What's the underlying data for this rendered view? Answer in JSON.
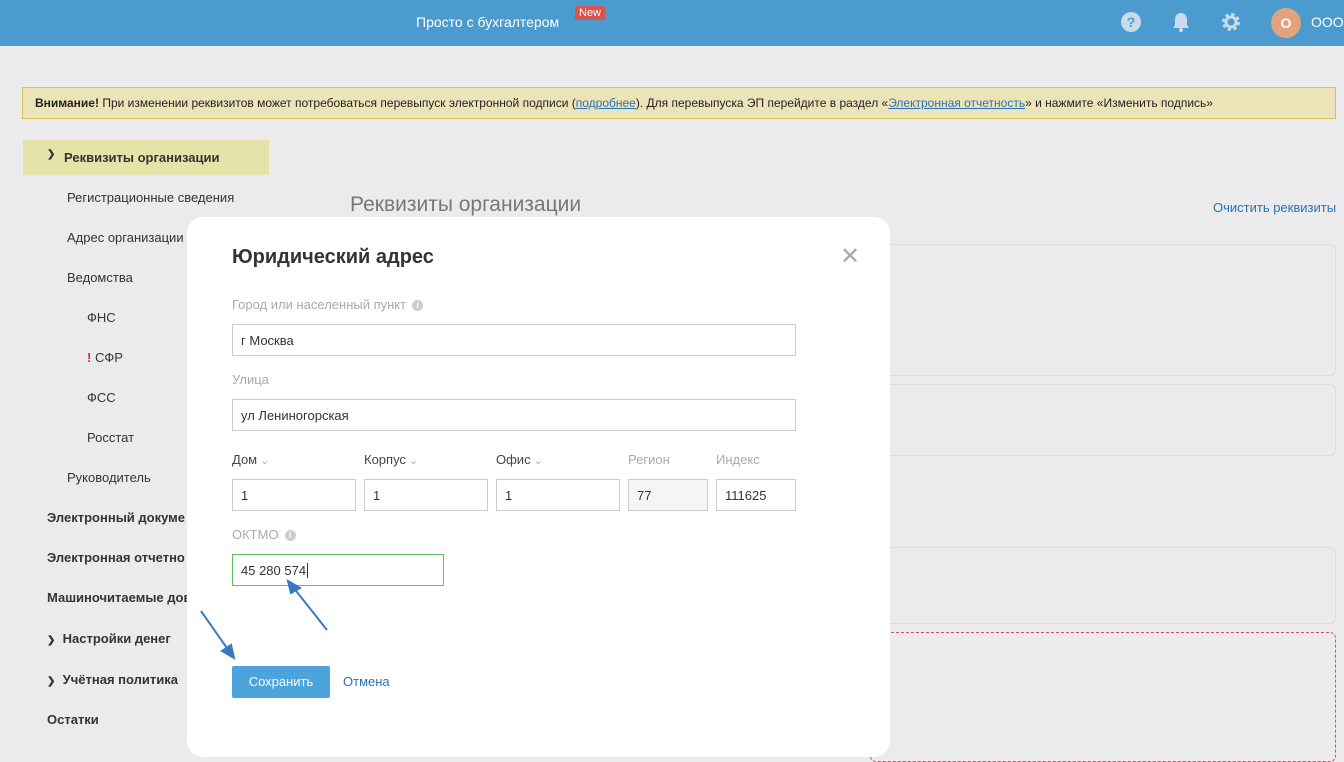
{
  "header": {
    "brand": "Просто с бухгалтером",
    "new_badge": "New",
    "avatar_letter": "О",
    "org": "ООО"
  },
  "warning": {
    "bold": "Внимание!",
    "text1": " При изменении реквизитов может потребоваться перевыпуск электронной подписи (",
    "link1": "подробнее",
    "text2": "). Для перевыпуска ЭП перейдите в раздел «",
    "link2": "Электронная отчетность",
    "text3": "» и нажмите «Изменить подпись»"
  },
  "sidebar": {
    "active": "Реквизиты организации",
    "items": [
      "Регистрационные сведения",
      "Адрес организации",
      "Ведомства",
      "ФНС",
      "СФР",
      "ФСС",
      "Росстат",
      "Руководитель",
      "Электронный докуме",
      "Электронная отчетно",
      "Машиночитаемые дов",
      "Настройки денег",
      "Учётная политика",
      "Остатки"
    ],
    "alert_mark": "!"
  },
  "main": {
    "title": "Реквизиты организации",
    "clear_link": "Очистить реквизиты"
  },
  "modal": {
    "title": "Юридический адрес",
    "city_label": "Город или населенный пункт",
    "city_value": "г Москва",
    "street_label": "Улица",
    "street_value": "ул Лениногорская",
    "house_label": "Дом",
    "house_value": "1",
    "korpus_label": "Корпус",
    "korpus_value": "1",
    "office_label": "Офис",
    "office_value": "1",
    "region_label": "Регион",
    "region_value": "77",
    "index_label": "Индекс",
    "index_value": "111625",
    "oktmo_label": "ОКТМО",
    "oktmo_value": "45 280 574",
    "save": "Сохранить",
    "cancel": "Отмена"
  },
  "colors": {
    "header": "#4b9bcf",
    "accent": "#4da3dc",
    "link": "#2a72b5",
    "focus": "#5cc35c"
  }
}
